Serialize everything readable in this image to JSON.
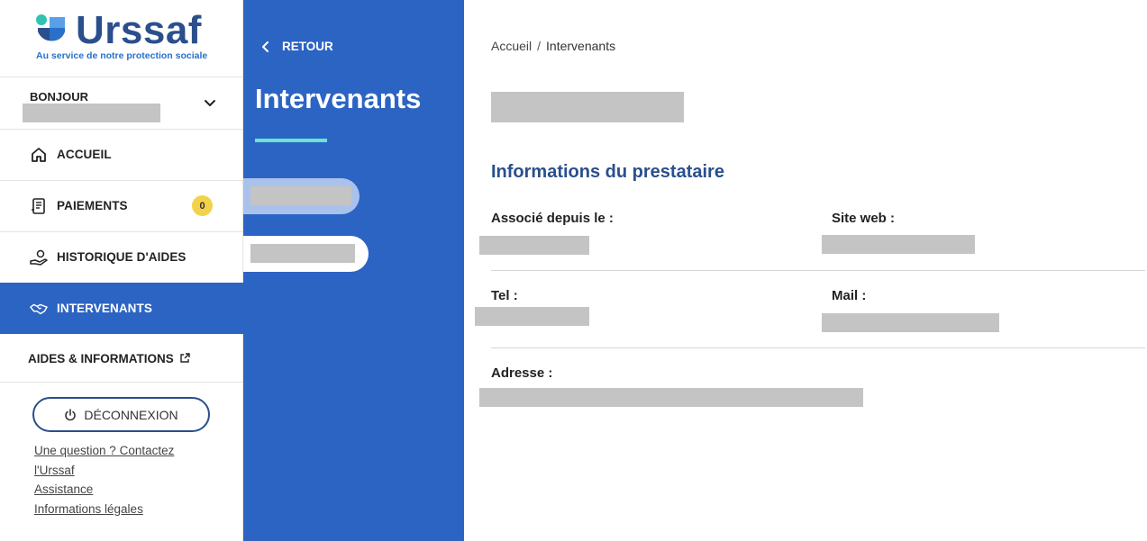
{
  "brand": {
    "name": "Urssaf",
    "tagline": "Au service de notre protection sociale",
    "color_primary": "#2a4f8c",
    "color_accent_blue": "#2c64c4",
    "color_accent_teal": "#6fe3cf"
  },
  "user": {
    "greeting": "BONJOUR"
  },
  "nav": {
    "items": [
      {
        "label": "ACCUEIL",
        "icon": "home-icon",
        "active": false
      },
      {
        "label": "PAIEMENTS",
        "icon": "receipt-icon",
        "active": false,
        "badge": "0"
      },
      {
        "label": "HISTORIQUE D'AIDES",
        "icon": "hand-coin-icon",
        "active": false
      },
      {
        "label": "INTERVENANTS",
        "icon": "handshake-icon",
        "active": true
      }
    ],
    "external": {
      "label": "AIDES & INFORMATIONS",
      "icon": "external-link-icon"
    }
  },
  "logout": {
    "label": "DÉCONNEXION",
    "icon": "power-icon"
  },
  "footer_links": [
    "Une question ? Contactez",
    "l'Urssaf",
    "Assistance",
    "Informations légales"
  ],
  "subpanel": {
    "back_label": "RETOUR",
    "title": "Intervenants"
  },
  "breadcrumb": {
    "home": "Accueil",
    "separator": "/",
    "current": "Intervenants"
  },
  "details": {
    "section_title": "Informations du prestataire",
    "fields": {
      "associe": "Associé depuis le :",
      "site_web": "Site web :",
      "tel": "Tel :",
      "mail": "Mail :",
      "adresse": "Adresse :"
    }
  }
}
